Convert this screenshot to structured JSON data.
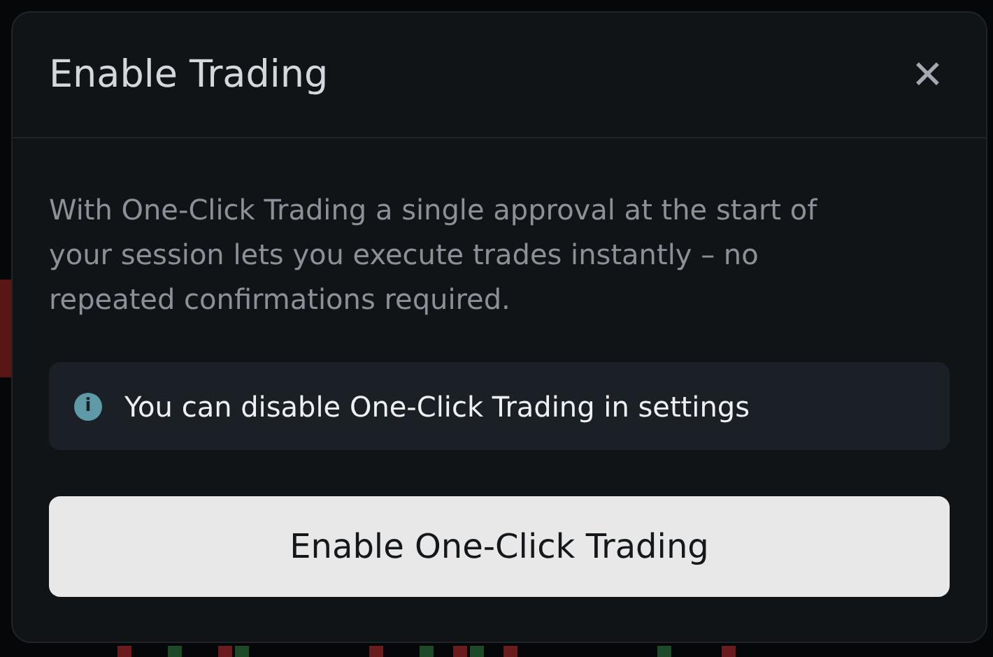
{
  "dialog": {
    "title": "Enable Trading",
    "close_label": "✕",
    "description": "With One-Click Trading a single approval at the start of your session lets you execute trades instantly – no repeated confirmations required.",
    "info": {
      "icon": "i",
      "text": "You can disable One-Click Trading in settings"
    },
    "button": {
      "label": "Enable One-Click Trading"
    }
  }
}
